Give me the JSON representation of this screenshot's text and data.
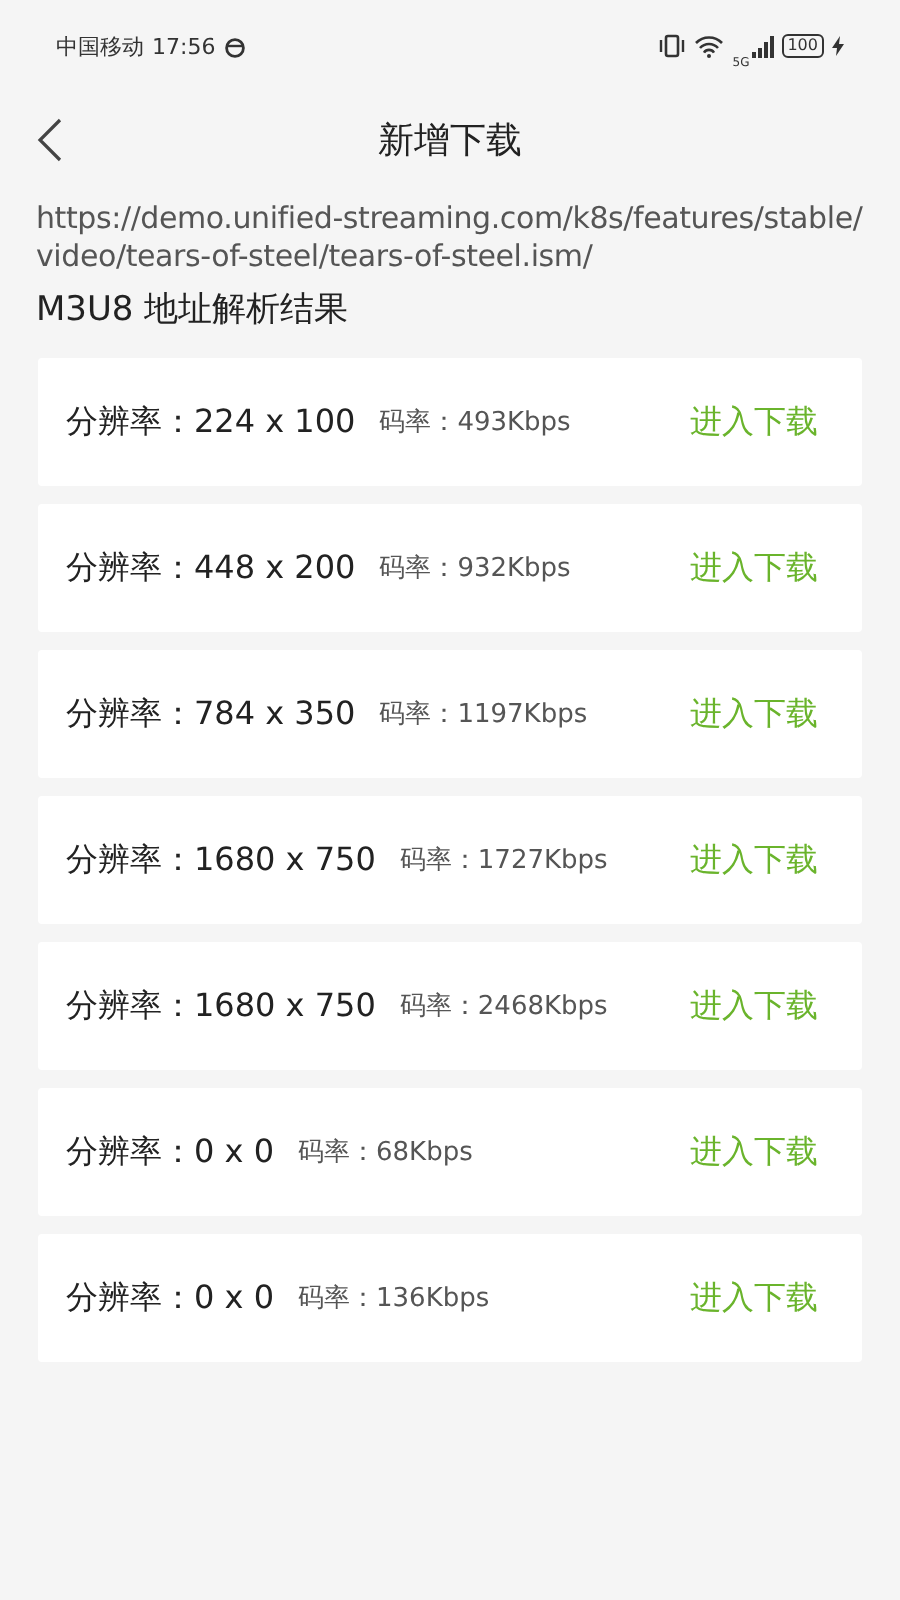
{
  "status_bar": {
    "carrier": "中国移动",
    "time": "17:56",
    "network": "5G",
    "battery": "100"
  },
  "header": {
    "title": "新增下载"
  },
  "url": "https://demo.unified-streaming.com/k8s/features/stable/video/tears-of-steel/tears-of-steel.ism/",
  "section_title": "M3U8 地址解析结果",
  "streams": [
    {
      "resolution": "分辨率：224 x 100",
      "bitrate": "码率：493Kbps",
      "action": "进入下载"
    },
    {
      "resolution": "分辨率：448 x 200",
      "bitrate": "码率：932Kbps",
      "action": "进入下载"
    },
    {
      "resolution": "分辨率：784 x 350",
      "bitrate": "码率：1197Kbps",
      "action": "进入下载"
    },
    {
      "resolution": "分辨率：1680 x 750",
      "bitrate": "码率：1727Kbps",
      "action": "进入下载"
    },
    {
      "resolution": "分辨率：1680 x 750",
      "bitrate": "码率：2468Kbps",
      "action": "进入下载"
    },
    {
      "resolution": "分辨率：0 x 0",
      "bitrate": "码率：68Kbps",
      "action": "进入下载"
    },
    {
      "resolution": "分辨率：0 x 0",
      "bitrate": "码率：136Kbps",
      "action": "进入下载"
    }
  ]
}
